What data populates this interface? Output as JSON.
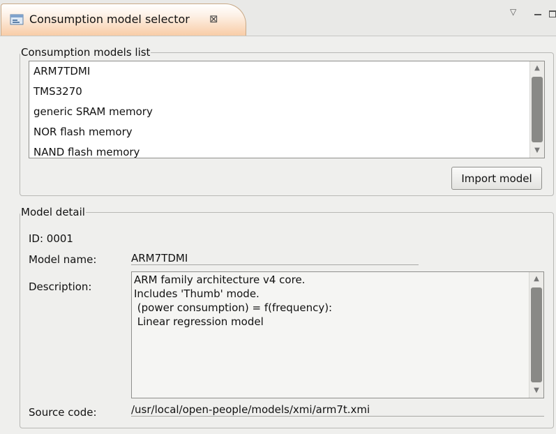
{
  "tab": {
    "title": "Consumption model selector",
    "icon": "view-icon",
    "close_glyph": "⊠",
    "view_menu_glyph": "▽"
  },
  "models_group": {
    "legend": "Consumption models list",
    "items": [
      "ARM7TDMI",
      "TMS3270",
      "generic SRAM memory",
      "NOR flash memory",
      "NAND flash memory"
    ],
    "import_button": "Import model"
  },
  "detail_group": {
    "legend": "Model detail",
    "id_text": "ID: 0001",
    "name_label": "Model name:",
    "name_value": "ARM7TDMI",
    "description_label": "Description:",
    "description_lines": [
      "ARM family architecture v4 core.",
      "Includes 'Thumb' mode.",
      " (power consumption) = f(frequency):",
      " Linear regression model"
    ],
    "source_label": "Source code:",
    "source_value": "/usr/local/open-people/models/xmi/arm7t.xmi"
  },
  "scroll_glyphs": {
    "up": "▲",
    "down": "▼"
  },
  "colors": {
    "tab_gradient_end": "#f8cba4",
    "background": "#efefed",
    "scroll_thumb": "#898986"
  }
}
